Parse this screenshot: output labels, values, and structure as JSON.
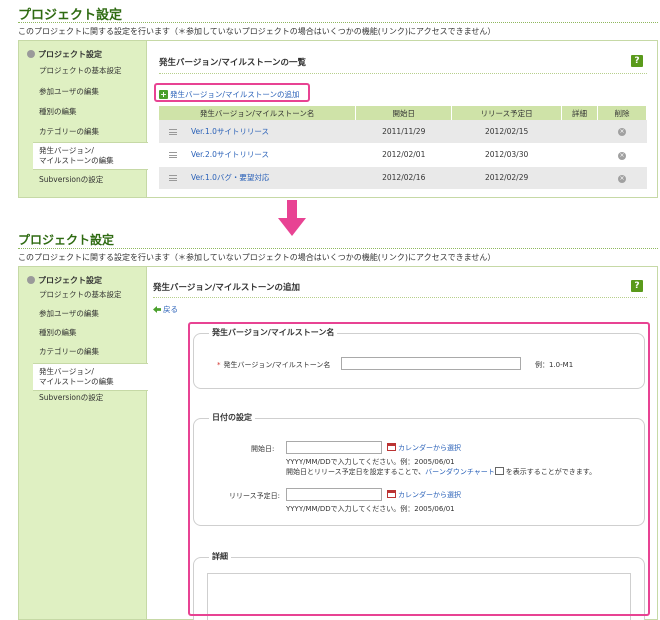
{
  "header": {
    "title": "プロジェクト設定",
    "description_top": "このプロジェクトに関する設定を行います（＊参加していないプロジェクトの場合はいくつかの機能(リンク)にアクセスできません）",
    "description_bottom": "このプロジェクトに関する設定を行います（＊参加していないプロジェクトの場合はいくつかの機能(リンク)にアクセスできません）"
  },
  "sidebar": {
    "heading": "プロジェクト設定",
    "items": [
      {
        "label": "プロジェクトの基本設定"
      },
      {
        "label": "参加ユーザの編集"
      },
      {
        "label": "種別の編集"
      },
      {
        "label": "カテゴリーの編集"
      },
      {
        "label_line1": "発生バージョン/",
        "label_line2": "マイルストーンの編集",
        "active": true
      },
      {
        "label": "Subversionの設定"
      }
    ]
  },
  "top_panel": {
    "section_title": "発生バージョン/マイルストーンの一覧",
    "help_label": "?",
    "add_link": "発生バージョン/マイルストーンの追加",
    "table": {
      "headers": [
        "発生バージョン/マイルストーン名",
        "開始日",
        "リリース予定日",
        "詳細",
        "削除"
      ],
      "rows": [
        {
          "name": "Ver.1.0サイトリリース",
          "start": "2011/11/29",
          "release": "2012/02/15",
          "delete": "×"
        },
        {
          "name": "Ver.2.0サイトリリース",
          "start": "2012/02/01",
          "release": "2012/03/30",
          "delete": "×"
        },
        {
          "name": "Ver.1.0バグ・要望対応",
          "start": "2012/02/16",
          "release": "2012/02/29",
          "delete": "×"
        }
      ]
    }
  },
  "bottom_panel": {
    "section_title": "発生バージョン/マイルストーンの追加",
    "help_label": "?",
    "back_link": "戻る",
    "fieldset_name": {
      "legend": "発生バージョン/マイルストーン名",
      "required_mark": "*",
      "label": "発生バージョン/マイルストーン名",
      "value": "",
      "example": "例：1.0-M1"
    },
    "fieldset_dates": {
      "legend": "日付の設定",
      "start_label": "開始日:",
      "start_value": "",
      "calendar_link": "カレンダーから選択",
      "format_hint": "YYYY/MM/DDで入力してください。例：2005/06/01",
      "gantt_note_prefix": "開始日とリリース予定日を設定することで、",
      "gantt_link": "バーンダウンチャート",
      "gantt_note_suffix": "を表示することができます。",
      "release_label": "リリース予定日:",
      "release_value": "",
      "release_calendar_link": "カレンダーから選択",
      "release_format_hint": "YYYY/MM/DDで入力してください。例：2005/06/01"
    },
    "fieldset_detail": {
      "legend": "詳細"
    }
  },
  "colors": {
    "brand_green": "#2f6b12",
    "sidebar_bg": "#dff0c2",
    "highlight": "#e84393",
    "link": "#2a61b8"
  }
}
